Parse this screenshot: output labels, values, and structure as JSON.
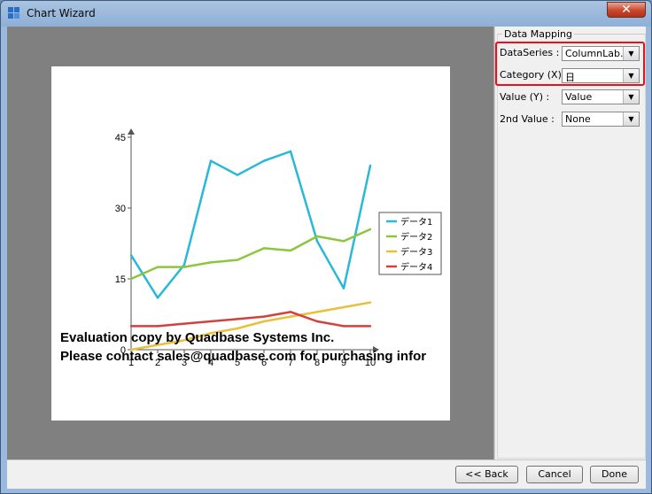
{
  "window": {
    "title": "Chart Wizard",
    "close_glyph": "✕"
  },
  "panel": {
    "title": "Data Mapping",
    "rows": [
      {
        "label": "DataSeries :",
        "value": "ColumnLab..."
      },
      {
        "label": "Category (X) :",
        "value": "日"
      },
      {
        "label": "Value (Y) :",
        "value": "Value"
      },
      {
        "label": "2nd Value :",
        "value": "None"
      }
    ]
  },
  "buttons": {
    "back": "<< Back",
    "cancel": "Cancel",
    "done": "Done"
  },
  "watermark": {
    "line1": "Evaluation copy by Quadbase Systems Inc.",
    "line2": "Please contact sales@quadbase.com for purchasing infor"
  },
  "chart_data": {
    "type": "line",
    "x": [
      1,
      2,
      3,
      4,
      5,
      6,
      7,
      8,
      9,
      10
    ],
    "x_tick_labels": [
      "1",
      "2",
      "3",
      "4",
      "5",
      "6",
      "7",
      "8",
      "9",
      "10"
    ],
    "y_tick_labels": [
      "0",
      "15",
      "30",
      "45"
    ],
    "ylim": [
      0,
      45
    ],
    "xlim": [
      1,
      10
    ],
    "legend_position": "right",
    "grid": false,
    "series": [
      {
        "name": "データ1",
        "color": "#2ab8d8",
        "values": [
          20,
          11,
          18,
          40,
          37,
          40,
          42,
          23,
          13,
          39
        ]
      },
      {
        "name": "データ2",
        "color": "#8cc63e",
        "values": [
          15,
          17.5,
          17.5,
          18.5,
          19,
          21.5,
          21,
          24,
          23,
          25.5
        ]
      },
      {
        "name": "データ3",
        "color": "#e8c13a",
        "values": [
          0,
          1,
          2,
          3.5,
          4.5,
          6,
          7,
          8,
          9,
          10
        ]
      },
      {
        "name": "データ4",
        "color": "#d2413e",
        "values": [
          5,
          5,
          5.5,
          6,
          6.5,
          7,
          8,
          6,
          5,
          5
        ]
      }
    ]
  }
}
